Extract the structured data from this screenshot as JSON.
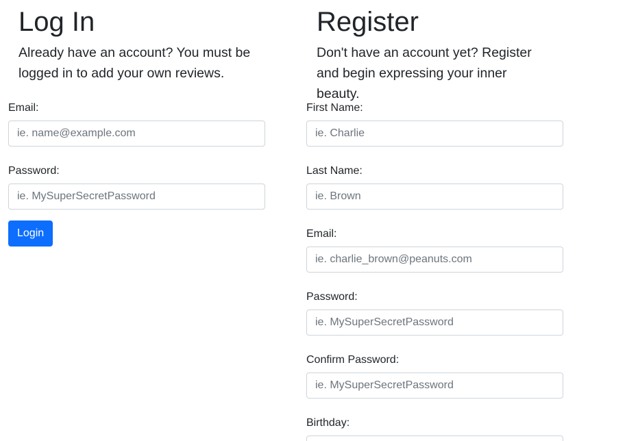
{
  "login": {
    "title": "Log In",
    "description": "Already have an account? You must be logged in to add your own reviews.",
    "email_label": "Email:",
    "email_placeholder": "ie. name@example.com",
    "email_value": "",
    "password_label": "Password:",
    "password_placeholder": "ie. MySuperSecretPassword",
    "password_value": "",
    "submit_label": "Login",
    "accent_color": "#0d6efd"
  },
  "register": {
    "title": "Register",
    "description": "Don't have an account yet? Register and begin expressing your inner beauty.",
    "first_name_label": "First Name:",
    "first_name_placeholder": "ie. Charlie",
    "last_name_label": "Last Name:",
    "last_name_placeholder": "ie. Brown",
    "email_label": "Email:",
    "email_placeholder": "ie. charlie_brown@peanuts.com",
    "password_label": "Password:",
    "password_placeholder": "ie. MySuperSecretPassword",
    "confirm_password_label": "Confirm Password:",
    "confirm_password_placeholder": "ie. MySuperSecretPassword",
    "birthday_label": "Birthday:",
    "birthday_value": ""
  }
}
